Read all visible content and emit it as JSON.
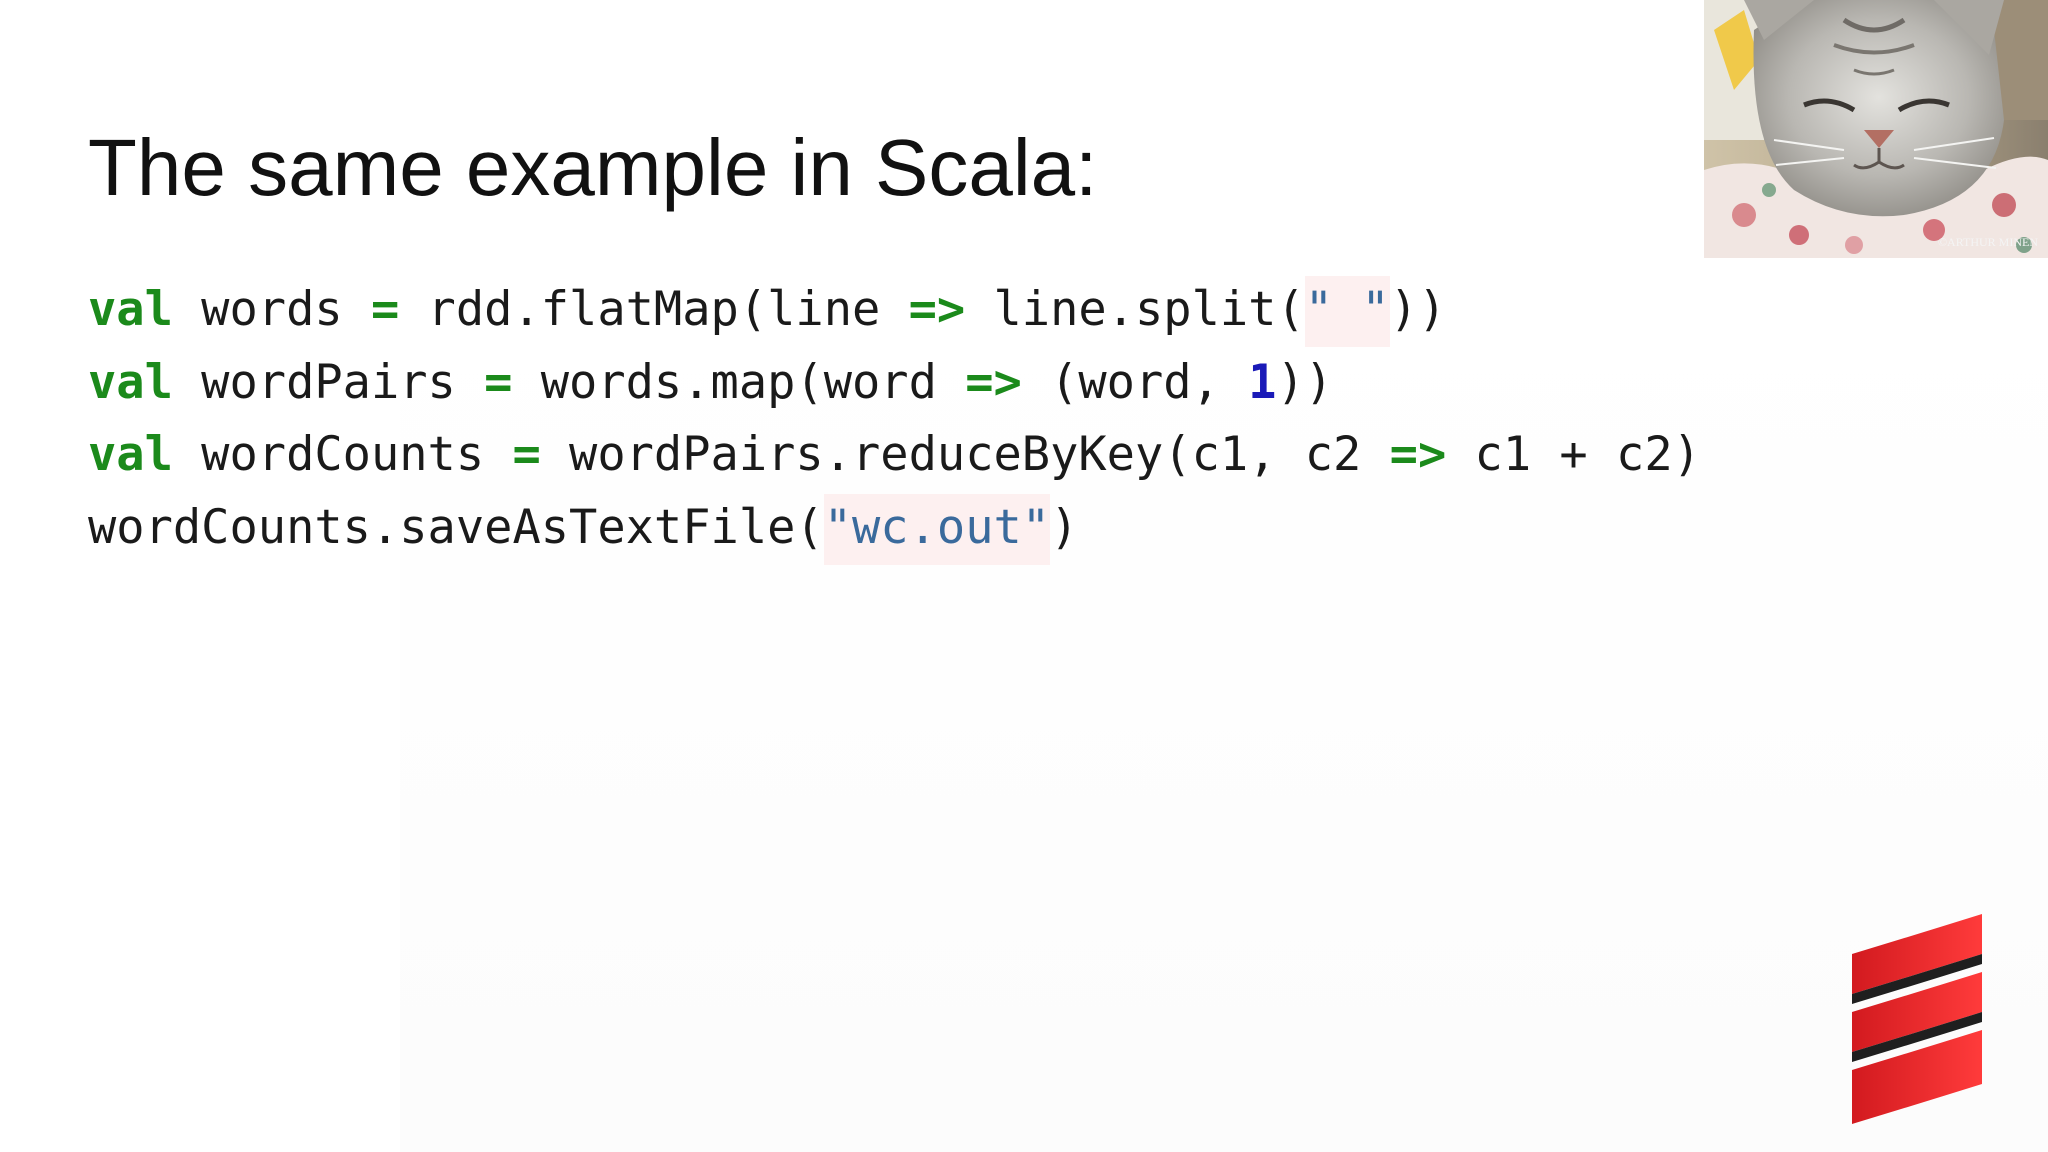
{
  "slide": {
    "title": "The same example in Scala:"
  },
  "code": {
    "line1": {
      "kw": "val",
      "name": " words ",
      "eq": "=",
      "expr": " rdd.flatMap(line ",
      "arrow": "=>",
      "call": " line.split(",
      "str": "\" \"",
      "close": "))"
    },
    "line2": {
      "kw": "val",
      "name": " wordPairs ",
      "eq": "=",
      "expr": " words.map(word ",
      "arrow": "=>",
      "tuple": " (word, ",
      "num": "1",
      "close": "))"
    },
    "line3": {
      "kw": "val",
      "name": " wordCounts ",
      "eq": "=",
      "expr": " wordPairs.reduceByKey(c1, c2 ",
      "arrow": "=>",
      "rest": " c1 + c2)"
    },
    "line4": {
      "expr": "wordCounts.saveAsTextFile(",
      "str": "\"wc.out\"",
      "close": ")"
    }
  },
  "webcam": {
    "watermark": "©ARTHUR MINEN"
  },
  "colors": {
    "keyword": "#1b8a1b",
    "number": "#1a1ab8",
    "string": "#3a6a9c",
    "logo": "#e8252a"
  },
  "icons": {
    "logo": "scala-logo-icon"
  }
}
